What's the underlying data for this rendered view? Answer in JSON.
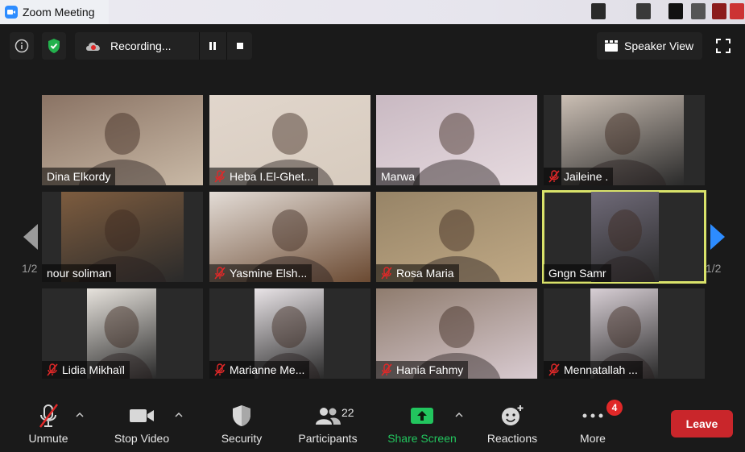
{
  "window": {
    "title": "Zoom Meeting"
  },
  "topbar": {
    "recording_label": "Recording...",
    "view_label": "Speaker View"
  },
  "participants_tiles": [
    {
      "name": "Dina Elkordy",
      "muted": false,
      "bg": "#c9b9a6",
      "vidbg": "#8a7364"
    },
    {
      "name": "Heba I.El-Ghet...",
      "muted": true,
      "bg": "#d7cbbe",
      "vidbg": "#e1d6cc"
    },
    {
      "name": "Marwa",
      "muted": false,
      "bg": "#e6dadf",
      "vidbg": "#c9b9c2"
    },
    {
      "name": "Jaileine .",
      "muted": true,
      "bg": "#2a2a2a",
      "vidbg": "#cbbfb4"
    },
    {
      "name": "nour soliman",
      "muted": false,
      "bg": "#2a2a2a",
      "vidbg": "#7d5c3f"
    },
    {
      "name": "Yasmine Elsh...",
      "muted": true,
      "bg": "#6b4a32",
      "vidbg": "#e3dcd6"
    },
    {
      "name": "Rosa Maria",
      "muted": true,
      "bg": "#c0a985",
      "vidbg": "#978467"
    },
    {
      "name": "Gngn Samr",
      "muted": false,
      "bg": "#2a2a2a",
      "vidbg": "#6f6a78"
    },
    {
      "name": "Lidia Mikhaïl",
      "muted": true,
      "bg": "#2a2a2a",
      "vidbg": "#e7e3dd"
    },
    {
      "name": "Marianne Me...",
      "muted": true,
      "bg": "#2a2a2a",
      "vidbg": "#e9e4e7"
    },
    {
      "name": "Hania Fahmy",
      "muted": true,
      "bg": "#d9cbd1",
      "vidbg": "#8f7c6e"
    },
    {
      "name": "Mennatallah ...",
      "muted": true,
      "bg": "#2a2a2a",
      "vidbg": "#d8cfd5"
    }
  ],
  "pagination": {
    "left": "1/2",
    "right": "1/2"
  },
  "toolbar": {
    "unmute": "Unmute",
    "stop_video": "Stop Video",
    "security": "Security",
    "participants": "Participants",
    "participants_count": "22",
    "share_screen": "Share Screen",
    "reactions": "Reactions",
    "more": "More",
    "more_badge": "4",
    "leave": "Leave"
  },
  "colors": {
    "share_green": "#22c55e",
    "leave_red": "#c9262b",
    "active_outline": "#d9e26a",
    "nav_blue": "#2d8cff"
  }
}
